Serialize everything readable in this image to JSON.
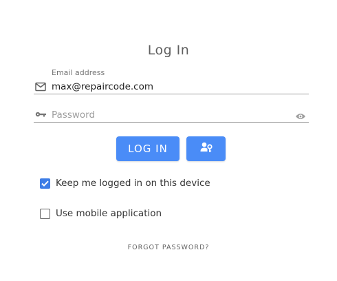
{
  "form": {
    "title": "Log In",
    "email": {
      "label": "Email address",
      "value": "max@repaircode.com",
      "icon": "mail-icon"
    },
    "password": {
      "placeholder": "Password",
      "icon": "key-icon",
      "toggle_icon": "eye-icon"
    },
    "buttons": {
      "login_label": "LOG IN",
      "key_login_icon": "user-key-icon"
    },
    "options": {
      "keep_logged_in": {
        "label": "Keep me logged in on this device",
        "checked": true
      },
      "use_mobile": {
        "label": "Use mobile application",
        "checked": false
      }
    },
    "forgot_label": "FORGOT PASSWORD?"
  },
  "colors": {
    "primary": "#4a8cf7",
    "checkbox": "#3d7de6"
  }
}
